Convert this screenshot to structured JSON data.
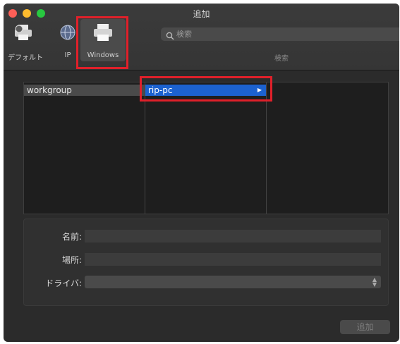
{
  "window": {
    "title": "追加"
  },
  "toolbar": {
    "default_label": "デフォルト",
    "ip_label": "IP",
    "windows_label": "Windows",
    "search_placeholder": "検索",
    "search_label": "検索"
  },
  "browser": {
    "column1": [
      {
        "label": "workgroup",
        "selected": true
      }
    ],
    "column2": [
      {
        "label": "rip-pc",
        "selected": true,
        "has_children": true
      }
    ]
  },
  "form": {
    "name_label": "名前:",
    "name_value": "",
    "location_label": "場所:",
    "location_value": "",
    "driver_label": "ドライバ:",
    "driver_value": ""
  },
  "buttons": {
    "add_label": "追加"
  },
  "colors": {
    "selection_blue": "#1c62cf",
    "highlight_red": "#e0202a",
    "window_bg": "#2b2b2b"
  },
  "icons": {
    "default": "printer-icon",
    "ip": "globe-icon",
    "windows": "printer-icon",
    "search": "search-icon"
  }
}
